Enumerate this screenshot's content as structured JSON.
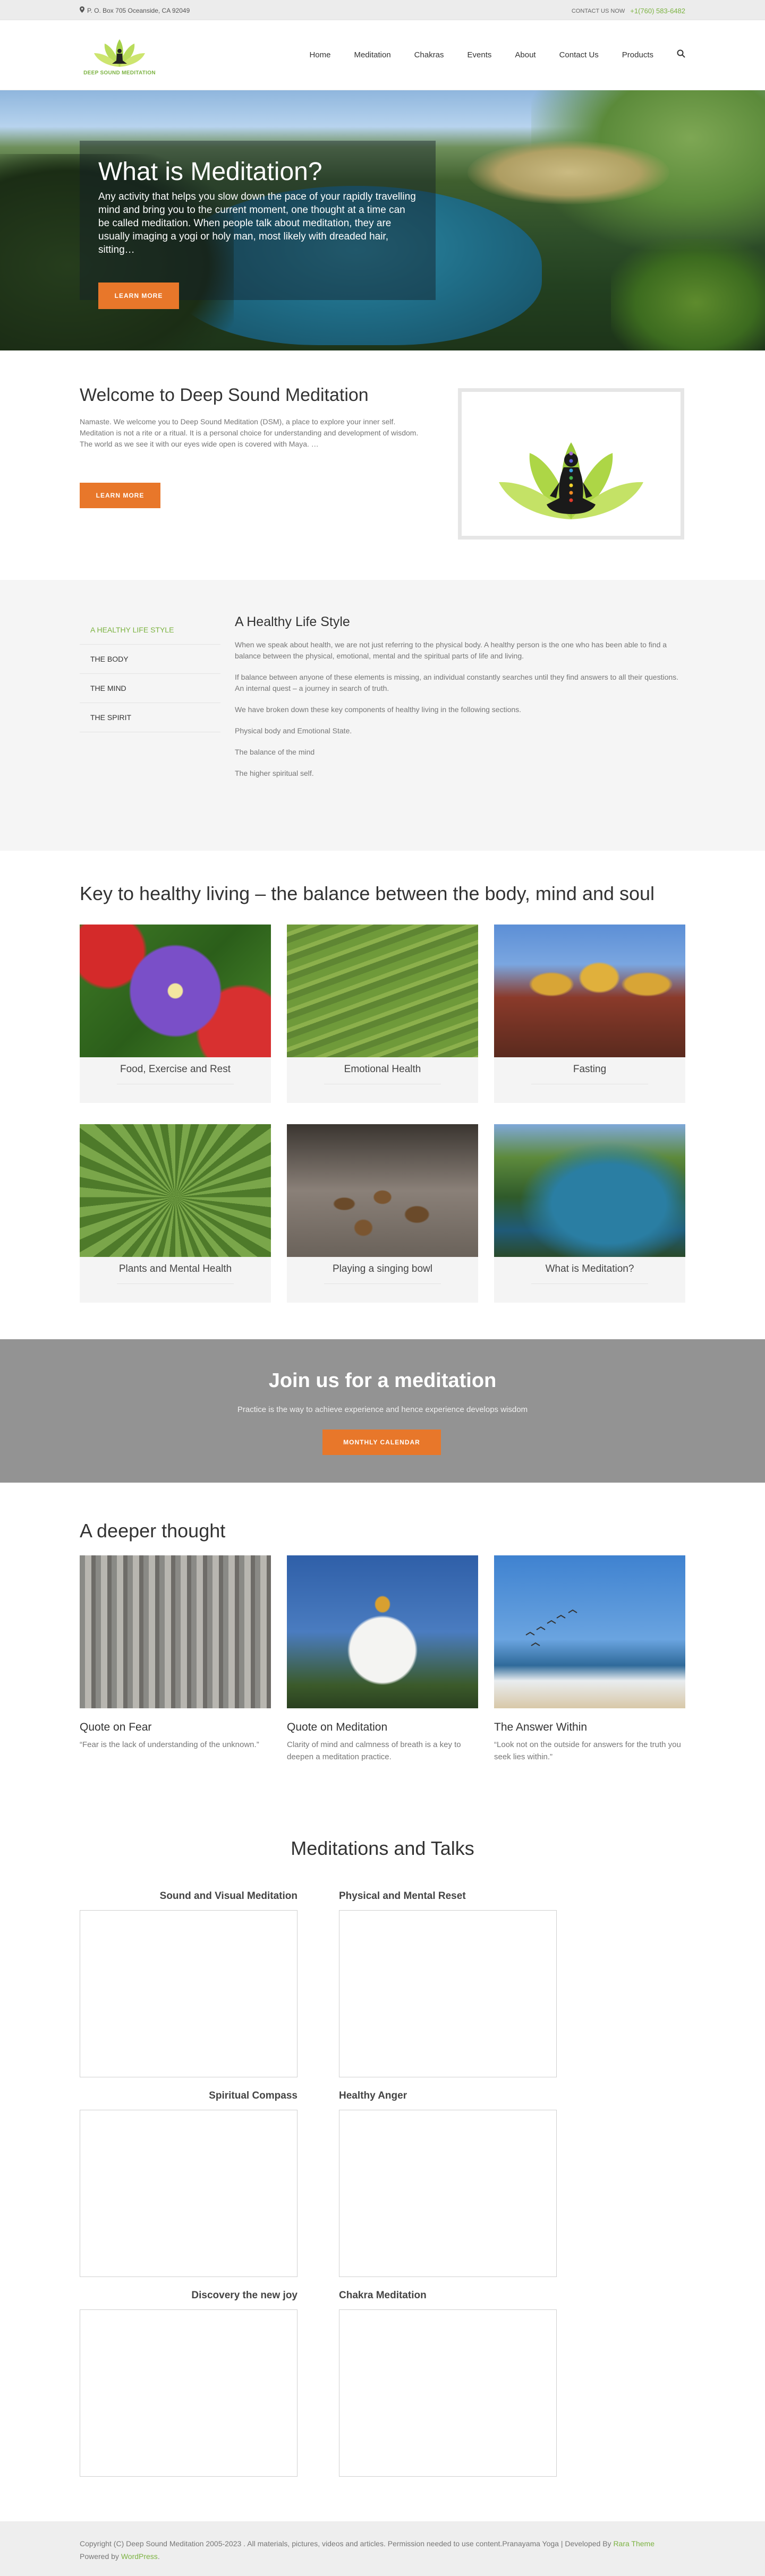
{
  "topbar": {
    "address": "P. O. Box 705 Oceanside, CA 92049",
    "contact_label": "CONTACT US NOW",
    "phone": "+1(760) 583-6482"
  },
  "logo": {
    "text": "DEEP SOUND MEDITATION"
  },
  "nav": {
    "items": [
      "Home",
      "Meditation",
      "Chakras",
      "Events",
      "About",
      "Contact Us",
      "Products"
    ]
  },
  "hero": {
    "title": "What is Meditation?",
    "text": "Any activity that helps you slow down the pace of your rapidly travelling mind and bring you to the current moment, one thought at a time can be called meditation. When people talk about meditation, they are usually imaging a yogi or holy man, most likely with dreaded hair, sitting…",
    "button": "LEARN MORE"
  },
  "welcome": {
    "title": "Welcome to Deep Sound Meditation",
    "text": "Namaste. We welcome you to Deep Sound Meditation (DSM), a place to explore your inner self. Meditation is not a rite or a ritual. It is a personal choice for understanding and development of wisdom. The world as we see it with our eyes wide open is covered with Maya. …",
    "button": "LEARN MORE"
  },
  "healthy_life": {
    "tabs": [
      "A HEALTHY LIFE STYLE",
      "THE BODY",
      "THE MIND",
      "THE SPIRIT"
    ],
    "title": "A Healthy Life Style",
    "paragraphs": [
      "When we speak about health, we are not just referring to the physical body. A healthy person is the one who has been able to find a balance between the physical, emotional, mental and the spiritual parts of life and living.",
      "If balance between anyone of these elements is missing, an individual constantly searches until they find answers to all their questions.  An internal quest – a journey in search of truth.",
      "We have broken down these key components of healthy living in the following sections.",
      "Physical body and Emotional State.",
      "The balance of the mind",
      "The higher spiritual self."
    ]
  },
  "key": {
    "title": "Key to healthy living – the balance between the body, mind and soul",
    "cards": [
      "Food, Exercise and Rest",
      "Emotional Health",
      "Fasting",
      "Plants and Mental Health",
      "Playing a singing bowl",
      "What is Meditation?"
    ]
  },
  "join": {
    "title": "Join us for a meditation",
    "text": "Practice is the way to achieve experience and hence experience develops wisdom",
    "button": "MONTHLY CALENDAR"
  },
  "deeper": {
    "title": "A deeper thought",
    "items": [
      {
        "title": "Quote on Fear",
        "quote": "“Fear is the lack of understanding of the unknown.”"
      },
      {
        "title": "Quote on Meditation",
        "quote": "Clarity of mind and calmness of breath is a key to deepen a meditation practice."
      },
      {
        "title": "The Answer Within",
        "quote": "“Look not on the outside for answers for the truth you seek lies within.”"
      }
    ]
  },
  "talks": {
    "title": "Meditations and Talks",
    "videos": [
      "Sound and Visual Meditation",
      "Physical and Mental Reset",
      "Spiritual Compass",
      "Healthy Anger",
      "Discovery the new joy",
      "Chakra Meditation"
    ]
  },
  "footer": {
    "text": "Copyright (C) Deep Sound Meditation 2005-2023 . All materials, pictures, videos and articles. Permission needed to use content.Pranayama Yoga | Developed By",
    "link1": "Rara Theme",
    "mid": "Powered by",
    "link2": "WordPress",
    "end": "."
  },
  "colors": {
    "accent_green": "#7cb342",
    "button_orange": "#e8772a",
    "join_gray": "#939393"
  },
  "icons": [
    "map-marker-icon",
    "search-icon",
    "logo-meditator-icon",
    "chakra-figure-icon"
  ]
}
